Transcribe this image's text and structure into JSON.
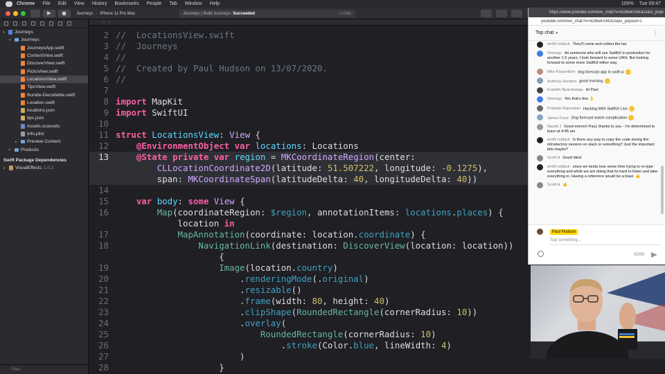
{
  "menubar": {
    "app": "Chrome",
    "items": [
      "File",
      "Edit",
      "View",
      "History",
      "Bookmarks",
      "People",
      "Tab",
      "Window",
      "Help"
    ],
    "battery": "100%",
    "clock": "Tue 09:47"
  },
  "toolbar": {
    "scheme": "Journeys",
    "device": "iPhone 11 Pro Max",
    "status_prefix": "Journeys | Build Journeys:",
    "status_result": "Succeeded",
    "status_time": "| 0.008s"
  },
  "navigator": {
    "items": [
      {
        "label": "Journeys",
        "indent": 0,
        "icon": "proj",
        "disc": "▾"
      },
      {
        "label": "Journeys",
        "indent": 1,
        "icon": "folder",
        "disc": "▾"
      },
      {
        "label": "JourneysApp.swift",
        "indent": 2,
        "icon": "swift"
      },
      {
        "label": "ContentView.swift",
        "indent": 2,
        "icon": "swift"
      },
      {
        "label": "DiscoverView.swift",
        "indent": 2,
        "icon": "swift"
      },
      {
        "label": "PicksView.swift",
        "indent": 2,
        "icon": "swift"
      },
      {
        "label": "LocationsView.swift",
        "indent": 2,
        "icon": "swift",
        "selected": true
      },
      {
        "label": "TipsView.swift",
        "indent": 2,
        "icon": "swift"
      },
      {
        "label": "Bundle-Decodable.swift",
        "indent": 2,
        "icon": "swift"
      },
      {
        "label": "Location.swift",
        "indent": 2,
        "icon": "swift"
      },
      {
        "label": "locations.json",
        "indent": 2,
        "icon": "json"
      },
      {
        "label": "tips.json",
        "indent": 2,
        "icon": "json"
      },
      {
        "label": "Assets.xcassets",
        "indent": 2,
        "icon": "xc"
      },
      {
        "label": "Info.plist",
        "indent": 2,
        "icon": "plist"
      },
      {
        "label": "Preview Content",
        "indent": 2,
        "icon": "folder",
        "disc": "▸"
      },
      {
        "label": "Products",
        "indent": 1,
        "icon": "folder",
        "disc": "▸"
      }
    ],
    "packages_header": "Swift Package Dependencies",
    "package": "VisualEffects",
    "package_version": "1.0.2",
    "filter_placeholder": "Filter"
  },
  "editor": {
    "highlight_line": 13,
    "lines": [
      {
        "n": "2",
        "html": "<span class=\"cm\">//  LocationsView.swift</span>"
      },
      {
        "n": "3",
        "html": "<span class=\"cm\">//  Journeys</span>"
      },
      {
        "n": "4",
        "html": "<span class=\"cm\">//</span>"
      },
      {
        "n": "5",
        "html": "<span class=\"cm\">//  Created by Paul Hudson on 13/07/2020.</span>"
      },
      {
        "n": "6",
        "html": "<span class=\"cm\">//</span>"
      },
      {
        "n": "7",
        "html": ""
      },
      {
        "n": "8",
        "html": "<span class=\"kw\">import</span> MapKit"
      },
      {
        "n": "9",
        "html": "<span class=\"kw\">import</span> SwiftUI"
      },
      {
        "n": "10",
        "html": ""
      },
      {
        "n": "11",
        "html": "<span class=\"kw\">struct</span> <span class=\"tp\">LocationsView</span>: <span class=\"ty\">View</span> {"
      },
      {
        "n": "12",
        "html": "    <span class=\"kw\">@EnvironmentObject</span> <span class=\"kw\">var</span> <span class=\"tp\">locations</span>: Locations"
      },
      {
        "n": "13",
        "html": "    <span class=\"kw\">@State</span> <span class=\"kw\">private</span> <span class=\"kw\">var</span> <span class=\"tp\">region</span> = <span class=\"ty\">MKCoordinateRegion</span>(center:"
      },
      {
        "n": "",
        "html": "        <span class=\"ty\">CLLocationCoordinate2D</span>(latitude: <span class=\"nm\">51.507222</span>, longitude: <span class=\"nm\">-0.1275</span>),"
      },
      {
        "n": "",
        "html": "        span: <span class=\"ty\">MKCoordinateSpan</span>(latitudeDelta: <span class=\"nm\">40</span>, longitudeDelta: <span class=\"nm\">40</span>))"
      },
      {
        "n": "14",
        "html": ""
      },
      {
        "n": "15",
        "html": "    <span class=\"kw\">var</span> <span class=\"tp\">body</span>: <span class=\"kw\">some</span> <span class=\"ty\">View</span> {"
      },
      {
        "n": "16",
        "html": "        <span class=\"fn\">Map</span>(coordinateRegion: <span class=\"id\">$region</span>, annotationItems: <span class=\"id\">locations</span>.<span class=\"id\">places</span>) {"
      },
      {
        "n": "",
        "html": "            location <span class=\"kw\">in</span>"
      },
      {
        "n": "17",
        "html": "            <span class=\"fn\">MapAnnotation</span>(coordinate: location.<span class=\"id\">coordinate</span>) {"
      },
      {
        "n": "18",
        "html": "                <span class=\"fn\">NavigationLink</span>(destination: <span class=\"fn\">DiscoverView</span>(location: location))"
      },
      {
        "n": "",
        "html": "                    {"
      },
      {
        "n": "19",
        "html": "                    <span class=\"fn\">Image</span>(location.<span class=\"id\">country</span>)"
      },
      {
        "n": "20",
        "html": "                        .<span class=\"id\">renderingMode</span>(.<span class=\"id\">original</span>)"
      },
      {
        "n": "21",
        "html": "                        .<span class=\"id\">resizable</span>()"
      },
      {
        "n": "22",
        "html": "                        .<span class=\"id\">frame</span>(width: <span class=\"nm\">80</span>, height: <span class=\"nm\">40</span>)"
      },
      {
        "n": "23",
        "html": "                        .<span class=\"id\">clipShape</span>(<span class=\"fn\">RoundedRectangle</span>(cornerRadius: <span class=\"nm\">10</span>))"
      },
      {
        "n": "24",
        "html": "                        .<span class=\"id\">overlay</span>("
      },
      {
        "n": "25",
        "html": "                            <span class=\"fn\">RoundedRectangle</span>(cornerRadius: <span class=\"nm\">10</span>)"
      },
      {
        "n": "26",
        "html": "                                .<span class=\"id\">stroke</span>(Color.<span class=\"id\">blue</span>, lineWidth: <span class=\"nm\">4</span>)"
      },
      {
        "n": "27",
        "html": "                        )"
      },
      {
        "n": "28",
        "html": "                    }"
      }
    ]
  },
  "chat": {
    "url": "https://www.youtube.com/live_chat?v=nOlbeKS9ODs&is_popout=1",
    "url_short": "youtube.com/live_chat?v=nOlbeKS9ODs&is_popout=1",
    "header": "Top chat",
    "messages": [
      {
        "who": "emiN roblack",
        "text": "They'll come and collect the tax",
        "color": "#222"
      },
      {
        "who": "Smongo",
        "text": "As someone who will use SwiftUI in production for another 1.5 years, I look forward to some UIKit. But looking forward to some more SwiftUI either way",
        "color": "#3f7ee0"
      },
      {
        "who": "Niko Klausnitzer",
        "text": "dog forecast app in swift ui",
        "color": "#b98d7a",
        "emoji": true
      },
      {
        "who": "Anthony Hordern",
        "text": "good morning",
        "color": "#8a9bb5",
        "emoji": true
      },
      {
        "who": "Franklin Byaruhanga",
        "text": "Hi Paul",
        "color": "#444"
      },
      {
        "who": "Smongo",
        "text": "Yes that's fine 👌",
        "color": "#3f7ee0"
      },
      {
        "who": "Prakash Rajendran",
        "text": "Hacking With SwiftUI Live",
        "color": "#6b6b6b",
        "emoji": true
      },
      {
        "who": "James Frost",
        "text": "Dog forecast watch complication",
        "color": "#8aa4c8",
        "emoji": true
      },
      {
        "who": "Navati J",
        "text": "Good mornin! Paul, thanks to you - I'm determined to learn at 4:45 am",
        "color": "#999"
      },
      {
        "who": "emiN roblack",
        "text": "Is there any way to copy the code during the introductory session on slack or something? Just the important bits maybe?",
        "color": "#222"
      },
      {
        "who": "Scott H",
        "text": "Good idea!",
        "color": "#888"
      },
      {
        "who": "emiN roblack",
        "text": "since we kinda lose some time trying to re-type everything and while we are doing that its hard to listen and take everything in. Having a reference would be a blast. 👍",
        "color": "#222"
      },
      {
        "who": "Scott H",
        "text": "👍",
        "color": "#888"
      }
    ],
    "input_user": "Paul Hudson",
    "input_placeholder": "Say something...",
    "counter": "0/200"
  }
}
